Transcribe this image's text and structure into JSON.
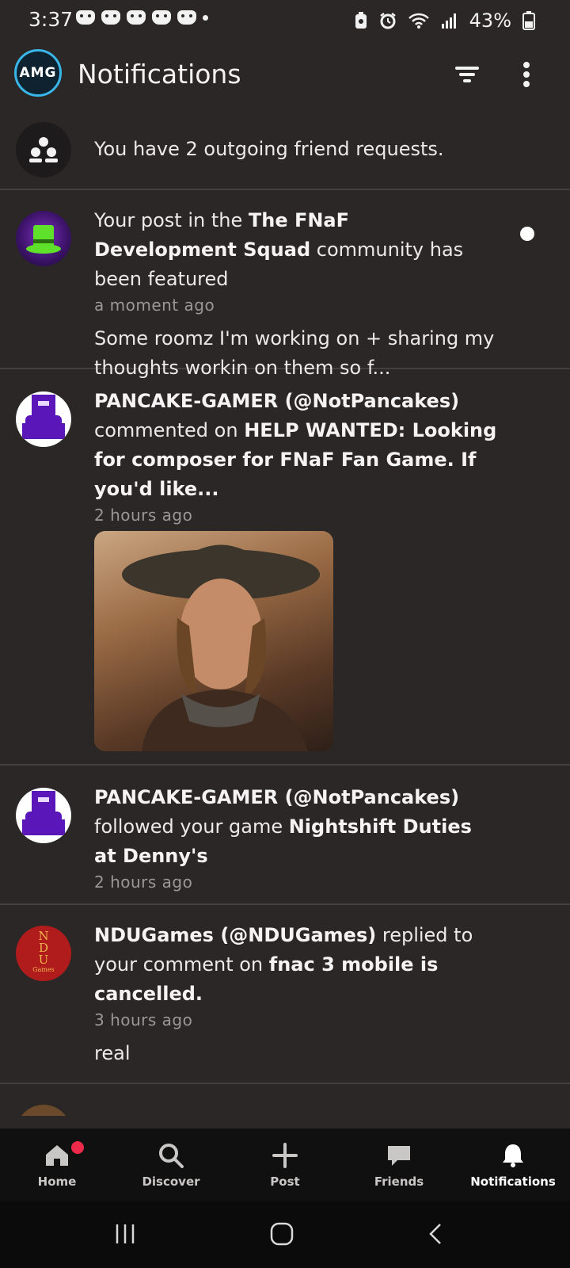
{
  "status_bar": {
    "time": "3:37",
    "battery_percent": "43%",
    "icons": [
      "game-controller-icon",
      "game-controller-icon",
      "game-controller-icon",
      "game-controller-icon",
      "game-controller-icon",
      "dot-icon",
      "battery-saver-icon",
      "alarm-icon",
      "wifi-icon",
      "signal-icon",
      "battery-icon"
    ]
  },
  "app_bar": {
    "logo_text": "AMG",
    "title": "Notifications",
    "filter_icon": "filter-icon",
    "more_icon": "more-vertical-icon"
  },
  "notifications": [
    {
      "type": "friend_requests",
      "text": "You have 2 outgoing friend requests."
    },
    {
      "type": "featured",
      "pre": "Your post in the ",
      "community": "The FNaF Development Squad",
      "post": " community has been featured",
      "time": "a moment ago",
      "preview": "Some roomz I'm working on + sharing my thoughts workin on them so f...",
      "unread": true
    },
    {
      "type": "comment",
      "user": "PANCAKE-GAMER (@NotPancakes)",
      "action": " commented on ",
      "target": "HELP WANTED: Looking for composer for FNaF Fan Game. If you'd like...",
      "time": "2 hours ago"
    },
    {
      "type": "follow",
      "user": "PANCAKE-GAMER (@NotPancakes)",
      "action": " followed your game ",
      "target": "Nightshift Duties at Denny's",
      "time": "2 hours ago"
    },
    {
      "type": "reply",
      "user": "NDUGames (@NDUGames)",
      "action": " replied to your comment on ",
      "target": "fnac 3 mobile is cancelled.",
      "time": "3 hours ago",
      "preview": "real",
      "avatar_letters": "NDU",
      "avatar_sub": "Games"
    }
  ],
  "bottom_nav": {
    "items": [
      {
        "label": "Home",
        "icon": "home-icon"
      },
      {
        "label": "Discover",
        "icon": "search-icon"
      },
      {
        "label": "Post",
        "icon": "plus-icon"
      },
      {
        "label": "Friends",
        "icon": "chat-icon"
      },
      {
        "label": "Notifications",
        "icon": "bell-icon",
        "active": true
      }
    ]
  },
  "system_nav": [
    "recents-icon",
    "home-circle-icon",
    "back-icon"
  ],
  "colors": {
    "background": "#2b2727",
    "divider": "#424040",
    "badge": "#ec2a4a",
    "logo_ring": "#39b5e8"
  }
}
